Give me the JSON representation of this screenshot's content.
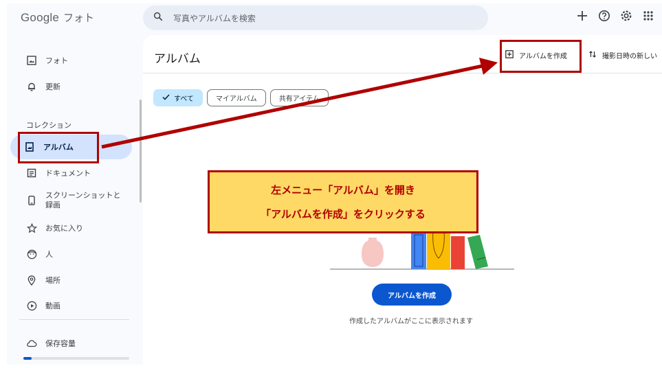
{
  "header": {
    "logo_google": "Google",
    "logo_product": "フォト",
    "search_placeholder": "写真やアルバムを検索"
  },
  "sidebar": {
    "items": [
      {
        "label": "フォト"
      },
      {
        "label": "更新"
      },
      {
        "label": "アルバム"
      },
      {
        "label": "ドキュメント"
      },
      {
        "label": "スクリーンショットと"
      },
      {
        "label": "録画"
      },
      {
        "label": "お気に入り"
      },
      {
        "label": "人"
      },
      {
        "label": "場所"
      },
      {
        "label": "動画"
      },
      {
        "label": "保存容量"
      }
    ],
    "section_label": "コレクション"
  },
  "main": {
    "title": "アルバム",
    "create_album_label": "アルバムを作成",
    "sort_label": "撮影日時の新しい",
    "chips": [
      {
        "label": "すべて"
      },
      {
        "label": "マイアルバム"
      },
      {
        "label": "共有アイテム"
      }
    ],
    "cta_label": "アルバムを作成",
    "cta_sub": "作成したアルバムがここに表示されます"
  },
  "annotation": {
    "line1": "左メニュー「アルバム」を開き",
    "line2": "「アルバムを作成」をクリックする",
    "color": "#b00000"
  },
  "colors": {
    "accent": "#0b57d0",
    "active_nav": "#d3e3fd",
    "selected_chip": "#c2e7ff",
    "callout_bg": "#ffd966"
  }
}
